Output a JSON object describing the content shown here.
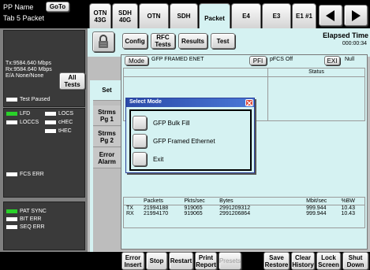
{
  "header": {
    "pp_name": "PP Name",
    "goto_label": "GoTo",
    "tab_label": "Tab 5 Packet"
  },
  "tabs": [
    {
      "label": "OTN 43G"
    },
    {
      "label": "SDH 40G"
    },
    {
      "label": "OTN"
    },
    {
      "label": "SDH"
    },
    {
      "label": "Packet",
      "active": true
    },
    {
      "label": "E4"
    },
    {
      "label": "E3"
    },
    {
      "label": "E1 #1"
    }
  ],
  "sidebar": {
    "tx_rate": "Tx:9584.640 Mbps",
    "rx_rate": "Rx:9584.640 Mbps",
    "ea": "E/A None/None",
    "all_tests": "All Tests",
    "test_paused": "Test Paused",
    "lfd": "LFD",
    "locs": "LOCS",
    "loccs": "LOCCS",
    "chec": "cHEC",
    "thec": "tHEC",
    "fcs_err": "FCS ERR",
    "pat_sync": "PAT SYNC",
    "bit_err": "BIT ERR",
    "seq_err": "SEQ ERR"
  },
  "toolbar": {
    "config": "Config",
    "rfc_tests": "RFC Tests",
    "results": "Results",
    "test": "Test",
    "elapsed_label": "Elapsed Time",
    "elapsed_value": "000:00:34"
  },
  "side_tabs": [
    {
      "label": "Set",
      "active": true
    },
    {
      "label": "Strms Pg 1"
    },
    {
      "label": "Strms Pg 2"
    },
    {
      "label": "Error Alarm"
    }
  ],
  "mode_row": {
    "mode_label": "Mode",
    "mode_value": "GFP FRAMED ENET",
    "pfi": "PFI",
    "pfcs": "pFCS Off",
    "exi": "EXI",
    "null": "Null",
    "status": "Status"
  },
  "dialog": {
    "title": "Select Mode",
    "options": [
      "GFP Bulk Fill",
      "GFP Framed Ethernet",
      "Exit"
    ]
  },
  "stats": {
    "headers": [
      "",
      "Packets",
      "Pkts/sec",
      "Bytes",
      "Mbit/sec",
      "%BW"
    ],
    "rows": [
      [
        "TX",
        "21994188",
        "919065",
        "2991209312",
        "999.944",
        "10.43"
      ],
      [
        "RX",
        "21994170",
        "919065",
        "2991206864",
        "999.944",
        "10.43"
      ]
    ]
  },
  "bottom": {
    "error_insert": "Error Insert",
    "stop": "Stop",
    "restart": "Restart",
    "print_report": "Print Report",
    "presets": "Presets",
    "save_restore": "Save Restore",
    "clear_history": "Clear History",
    "lock_screen": "Lock Screen",
    "shut_down": "Shut Down"
  }
}
